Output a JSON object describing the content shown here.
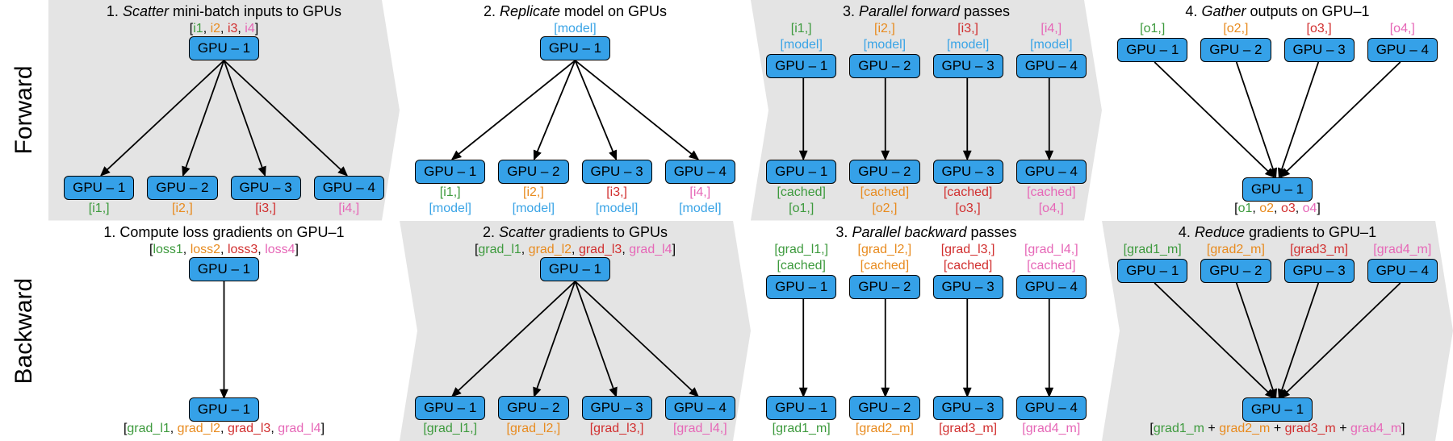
{
  "side": {
    "forward": "Forward",
    "backward": "Backward"
  },
  "gpu": {
    "g1": "GPU – 1",
    "g2": "GPU – 2",
    "g3": "GPU – 3",
    "g4": "GPU – 4"
  },
  "fwd": {
    "p1": {
      "title_pre": "1. ",
      "title_em": "Scatter",
      "title_post": " mini-batch inputs to GPUs",
      "top": "[i1, i2, i3, i4]",
      "bot": [
        "[i1,]",
        "[i2,]",
        "[i3,]",
        "[i4,]"
      ]
    },
    "p2": {
      "title_pre": "2. ",
      "title_em": "Replicate",
      "title_post": " model on GPUs",
      "top": "[model]",
      "bot_line1": [
        "[i1,]",
        "[i2,]",
        "[i3,]",
        "[i4,]"
      ],
      "bot_line2": [
        "[model]",
        "[model]",
        "[model]",
        "[model]"
      ]
    },
    "p3": {
      "title_pre": "3. ",
      "title_em": "Parallel forward",
      "title_post": " passes",
      "top_line1": [
        "[i1,]",
        "[i2,]",
        "[i3,]",
        "[i4,]"
      ],
      "top_line2": [
        "[model]",
        "[model]",
        "[model]",
        "[model]"
      ],
      "bot_line1": [
        "[cached]",
        "[cached]",
        "[cached]",
        "[cached]"
      ],
      "bot_line2": [
        "[o1,]",
        "[o2,]",
        "[o3,]",
        "[o4,]"
      ]
    },
    "p4": {
      "title_pre": "4. ",
      "title_em": "Gather",
      "title_post": " outputs on GPU–1",
      "top": [
        "[o1,]",
        "[o2,]",
        "[o3,]",
        "[o4,]"
      ],
      "bot": "[o1, o2, o3, o4]"
    }
  },
  "bwd": {
    "p1": {
      "title": "1. Compute loss gradients on GPU–1",
      "top": "[loss1, loss2, loss3, loss4]",
      "bot": "[grad_l1, grad_l2, grad_l3, grad_l4]"
    },
    "p2": {
      "title_pre": "2. ",
      "title_em": "Scatter",
      "title_post": " gradients to GPUs",
      "top": "[grad_l1, grad_l2, grad_l3, grad_l4]",
      "bot": [
        "[grad_l1,]",
        "[grad_l2,]",
        "[grad_l3,]",
        "[grad_l4,]"
      ]
    },
    "p3": {
      "title_pre": "3. ",
      "title_em": "Parallel backward",
      "title_post": " passes",
      "top_line1": [
        "[grad_l1,]",
        "[grad_l2,]",
        "[grad_l3,]",
        "[grad_l4,]"
      ],
      "top_line2": [
        "[cached]",
        "[cached]",
        "[cached]",
        "[cached]"
      ],
      "bot": [
        "[grad1_m]",
        "[grad2_m]",
        "[grad3_m]",
        "[grad4_m]"
      ]
    },
    "p4": {
      "title_pre": "4. ",
      "title_em": "Reduce",
      "title_post": " gradients to GPU–1",
      "top": [
        "[grad1_m]",
        "[grad2_m]",
        "[grad3_m]",
        "[grad4_m]"
      ],
      "bot": "[grad1_m + grad2_m + grad3_m + grad4_m]"
    }
  }
}
